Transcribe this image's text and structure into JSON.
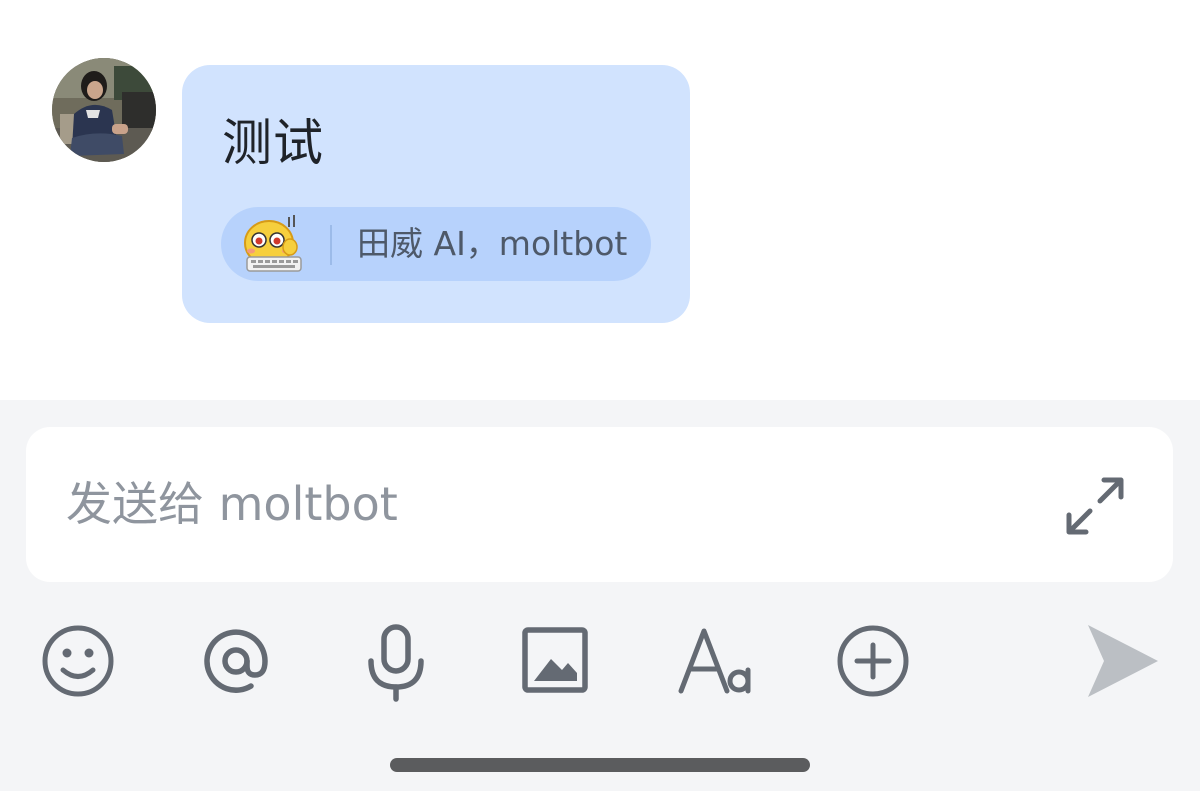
{
  "chat": {
    "message": {
      "text": "测试",
      "reaction": {
        "emoji_icon": "typing-cat-emoji",
        "users": "田威 AI，moltbot"
      }
    },
    "bubble_color": "#d1e3fe",
    "reaction_color": "#b7d2fc"
  },
  "composer": {
    "placeholder": "发送给 moltbot",
    "value": "",
    "icons": {
      "expand": "expand-icon",
      "emoji": "smiley-icon",
      "mention": "at-sign-icon",
      "voice": "microphone-icon",
      "image": "image-icon",
      "format": "text-format-icon",
      "more": "plus-circle-icon",
      "send": "send-icon"
    },
    "icon_color": "#646a73",
    "send_color": "#bbbfc4"
  }
}
